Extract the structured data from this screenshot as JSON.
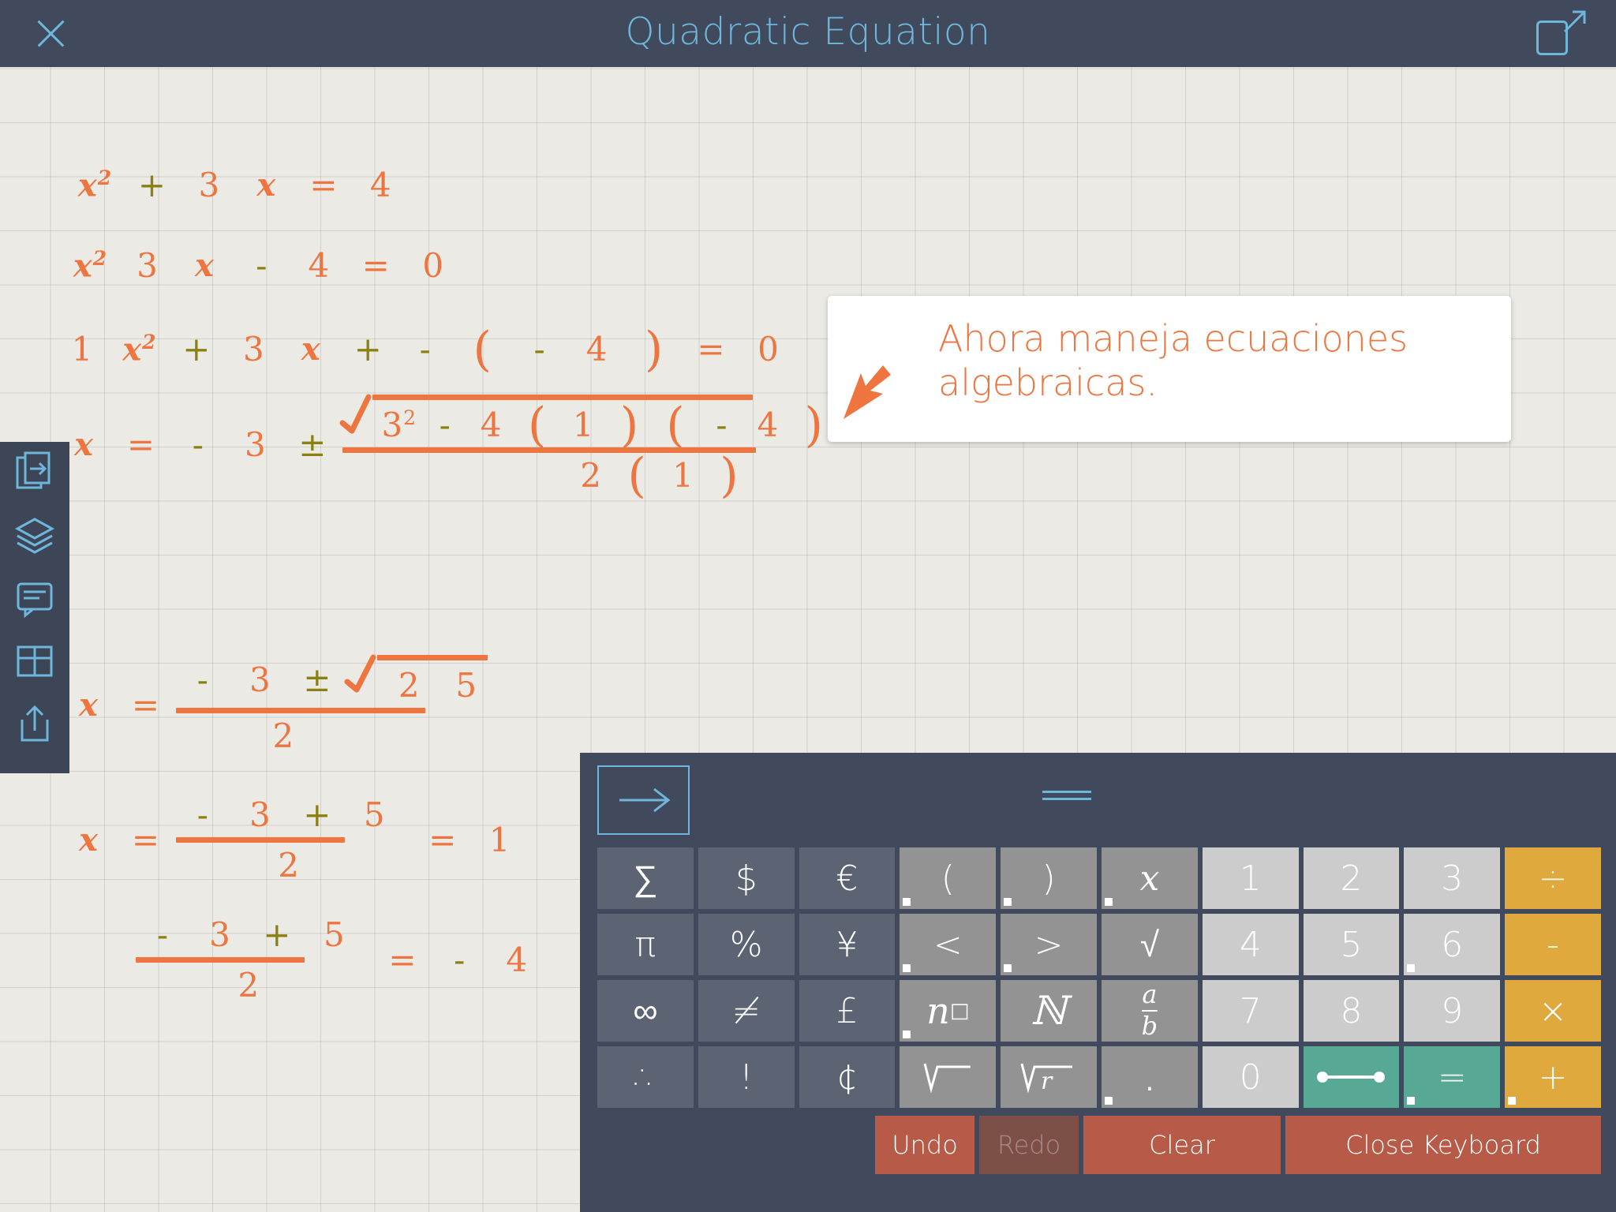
{
  "titlebar": {
    "title": "Quadratic Equation",
    "close_icon": "close-icon",
    "expand_icon": "expand-icon"
  },
  "sidebar": {
    "items": [
      {
        "name": "new-page-icon",
        "label": "New Page"
      },
      {
        "name": "layers-icon",
        "label": "Layers"
      },
      {
        "name": "notes-icon",
        "label": "Notes"
      },
      {
        "name": "grid-icon",
        "label": "Grid"
      },
      {
        "name": "share-icon",
        "label": "Share"
      }
    ]
  },
  "callout": {
    "text": "Ahora maneja ecuaciones algebraicas.",
    "arrow_icon": "arrow-down-left-icon",
    "accent": "#ef7540"
  },
  "worksheet": {
    "accent_orange": "#ef7540",
    "accent_olive": "#8b8112",
    "lines": [
      {
        "id": "line-1",
        "tokens": [
          "x",
          "2",
          "+",
          "3",
          "x",
          "=",
          "4"
        ],
        "display": "x² + 3 x = 4"
      },
      {
        "id": "line-2",
        "tokens": [
          "x",
          "2",
          "3",
          "x",
          "-",
          "4",
          "=",
          "0"
        ],
        "display": "x² 3 x - 4 = 0"
      },
      {
        "id": "line-3",
        "tokens": [
          "1",
          "x",
          "2",
          "+",
          "3",
          "x",
          "+",
          "-",
          "(",
          "-",
          "4",
          ")",
          "=",
          "0"
        ],
        "display": "1 x² + 3 x + - ( - 4 ) = 0"
      },
      {
        "id": "line-4",
        "display": "x = - 3 ± sqrt(3² - 4 ( 1 ) ( - 4 )) / 2 ( 1 )",
        "lhs": "x",
        "rel": "=",
        "prefix": [
          "-",
          "3",
          "±"
        ],
        "numerator": [
          "3",
          "2",
          "-",
          "4",
          "(",
          "1",
          ")",
          "(",
          "-",
          "4",
          ")"
        ],
        "denominator": [
          "2",
          "(",
          "1",
          ")"
        ]
      },
      {
        "id": "line-5",
        "display": "x = ( - 3 ± sqrt(25) ) / 2",
        "lhs": "x",
        "rel": "=",
        "numerator": [
          "-",
          "3",
          "±",
          "2",
          "5"
        ],
        "denominator": [
          "2"
        ]
      },
      {
        "id": "line-6",
        "display": "x = ( - 3 + 5 ) / 2 = 1",
        "lhs": "x",
        "rel": "=",
        "numerator": [
          "-",
          "3",
          "+",
          "5"
        ],
        "denominator": [
          "2"
        ],
        "rel2": "=",
        "result": "1"
      },
      {
        "id": "line-7",
        "display": "( - 3 + 5 ) / 2 = - 4",
        "numerator": [
          "-",
          "3",
          "+",
          "5"
        ],
        "denominator": [
          "2"
        ],
        "rel2": "=",
        "result_sign": "-",
        "result": "4"
      }
    ]
  },
  "keyboard": {
    "goto_icon": "arrow-right-icon",
    "handle_icon": "drag-handle-icon",
    "rows": [
      [
        {
          "label": "∑",
          "style": "dark",
          "name": "key-sigma",
          "dot": false
        },
        {
          "label": "$",
          "style": "dark",
          "name": "key-dollar",
          "dot": false
        },
        {
          "label": "€",
          "style": "dark",
          "name": "key-euro",
          "dot": false
        },
        {
          "label": "(",
          "style": "mid",
          "name": "key-paren-open",
          "dot": true
        },
        {
          "label": ")",
          "style": "mid",
          "name": "key-paren-close",
          "dot": true
        },
        {
          "label": "x",
          "style": "mid",
          "name": "key-x",
          "dot": true,
          "serif": true
        },
        {
          "label": "1",
          "style": "light",
          "name": "key-1",
          "dot": false
        },
        {
          "label": "2",
          "style": "light",
          "name": "key-2",
          "dot": false
        },
        {
          "label": "3",
          "style": "light",
          "name": "key-3",
          "dot": false
        },
        {
          "label": "÷",
          "style": "gold",
          "name": "key-divide",
          "dot": false
        }
      ],
      [
        {
          "label": "π",
          "style": "dark",
          "name": "key-pi",
          "dot": false
        },
        {
          "label": "%",
          "style": "dark",
          "name": "key-percent",
          "dot": false
        },
        {
          "label": "¥",
          "style": "dark",
          "name": "key-yen",
          "dot": false
        },
        {
          "label": "<",
          "style": "mid",
          "name": "key-less-than",
          "dot": true
        },
        {
          "label": ">",
          "style": "mid",
          "name": "key-greater-than",
          "dot": true
        },
        {
          "label": "√",
          "style": "mid",
          "name": "key-sqrt",
          "dot": false
        },
        {
          "label": "4",
          "style": "light",
          "name": "key-4",
          "dot": false
        },
        {
          "label": "5",
          "style": "light",
          "name": "key-5",
          "dot": false
        },
        {
          "label": "6",
          "style": "light",
          "name": "key-6",
          "dot": true
        },
        {
          "label": "-",
          "style": "gold",
          "name": "key-minus",
          "dot": false
        }
      ],
      [
        {
          "label": "∞",
          "style": "dark",
          "name": "key-infinity",
          "dot": false
        },
        {
          "label": "≠",
          "style": "dark",
          "name": "key-not-equal",
          "dot": false
        },
        {
          "label": "£",
          "style": "dark",
          "name": "key-pound",
          "dot": false
        },
        {
          "label": "n□",
          "style": "mid",
          "name": "key-power",
          "dot": true,
          "serif": true
        },
        {
          "label": "ℕ",
          "style": "mid",
          "name": "key-variable-n",
          "dot": false,
          "serif": true
        },
        {
          "label": "a/b",
          "style": "mid",
          "name": "key-fraction",
          "dot": false
        },
        {
          "label": "7",
          "style": "light",
          "name": "key-7",
          "dot": false
        },
        {
          "label": "8",
          "style": "light",
          "name": "key-8",
          "dot": false
        },
        {
          "label": "9",
          "style": "light",
          "name": "key-9",
          "dot": false
        },
        {
          "label": "×",
          "style": "gold",
          "name": "key-multiply",
          "dot": false
        }
      ],
      [
        {
          "label": "∴",
          "style": "dark",
          "name": "key-therefore",
          "dot": false
        },
        {
          "label": "!",
          "style": "dark",
          "name": "key-factorial",
          "dot": false
        },
        {
          "label": "¢",
          "style": "dark",
          "name": "key-cent",
          "dot": false
        },
        {
          "label": "√ ",
          "style": "mid",
          "name": "key-radical-empty",
          "dot": false
        },
        {
          "label": "√r",
          "style": "mid",
          "name": "key-radical-r",
          "dot": false
        },
        {
          "label": "·",
          "style": "mid",
          "name": "key-decimal-point",
          "dot": true
        },
        {
          "label": "0",
          "style": "light",
          "name": "key-0",
          "dot": false
        },
        {
          "label": "—",
          "style": "teal",
          "name": "key-line-segment",
          "dot": false
        },
        {
          "label": "=",
          "style": "teal",
          "name": "key-equals",
          "dot": true
        },
        {
          "label": "+",
          "style": "gold",
          "name": "key-plus",
          "dot": true
        }
      ]
    ],
    "actions": [
      {
        "label": "Undo",
        "name": "undo-button",
        "style": "undo"
      },
      {
        "label": "Redo",
        "name": "redo-button",
        "style": "redo"
      },
      {
        "label": "Clear",
        "name": "clear-button",
        "style": "clear"
      },
      {
        "label": "Close Keyboard",
        "name": "close-keyboard-button",
        "style": "close"
      }
    ]
  }
}
